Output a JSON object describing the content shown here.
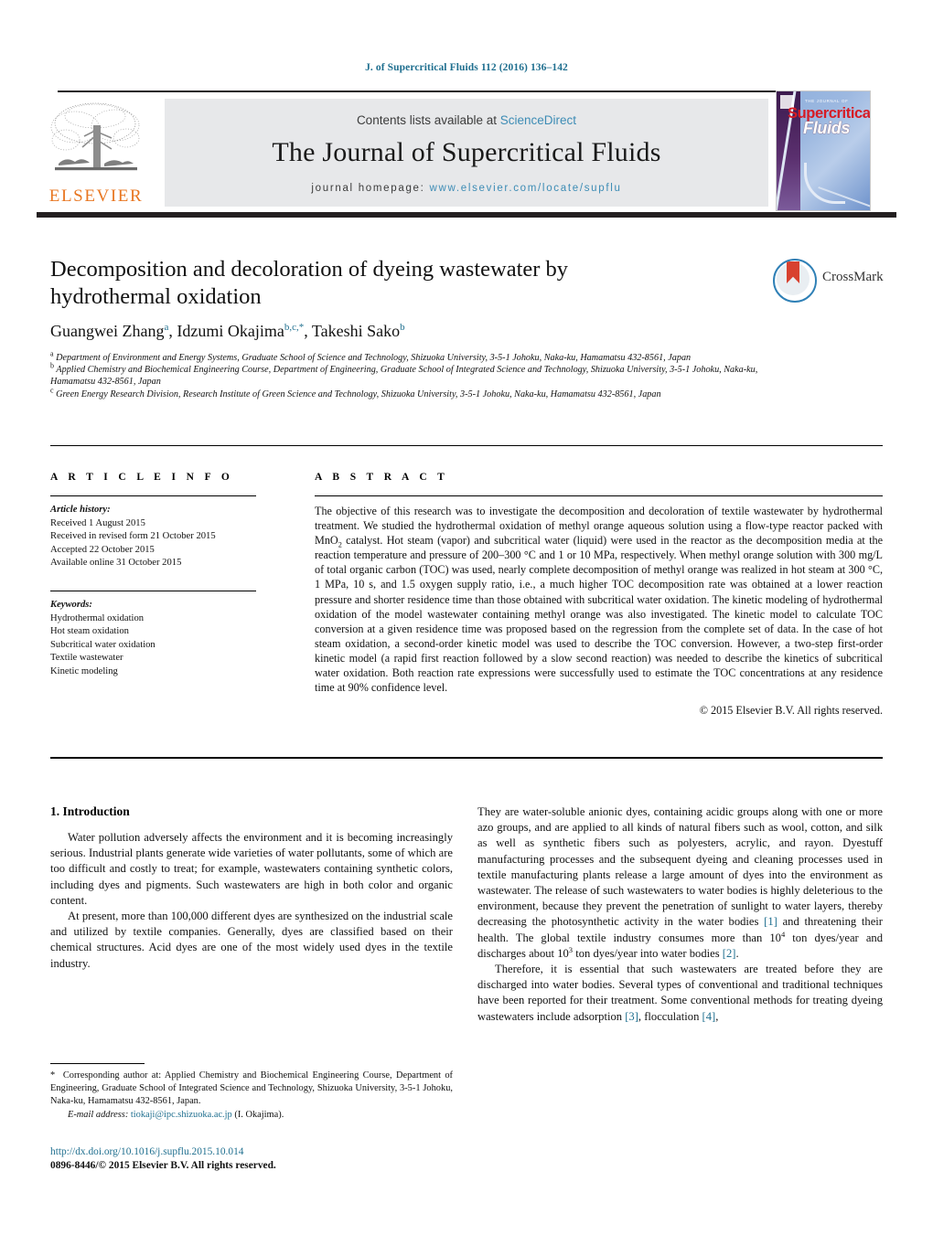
{
  "running_head": "J. of Supercritical Fluids 112 (2016) 136–142",
  "masthead": {
    "contents_prefix": "Contents lists available at ",
    "sciencedirect": "ScienceDirect",
    "journal_title": "The Journal of Supercritical Fluids",
    "homepage_label": "journal homepage:",
    "homepage_url": "www.elsevier.com/locate/supflu",
    "publisher_logo_text": "ELSEVIER",
    "cover": {
      "line1": "THE JOURNAL OF",
      "line2": "Supercritical",
      "line3": "Fluids"
    },
    "accent_gray": "#e7e8ea",
    "link_blue": "#3d8cb5",
    "elsevier_orange": "#e87722"
  },
  "crossmark": {
    "label": "CrossMark"
  },
  "article": {
    "title": "Decomposition and decoloration of dyeing wastewater by hydrothermal oxidation",
    "authors_html": "Guangwei Zhang<sup>a</sup>, Idzumi Okajima<sup>b,c,*</sup>, Takeshi Sako<sup>b</sup>",
    "affiliations": [
      "Department of Environment and Energy Systems, Graduate School of Science and Technology, Shizuoka University, 3-5-1 Johoku, Naka-ku, Hamamatsu 432-8561, Japan",
      "Applied Chemistry and Biochemical Engineering Course, Department of Engineering, Graduate School of Integrated Science and Technology, Shizuoka University, 3-5-1 Johoku, Naka-ku, Hamamatsu 432-8561, Japan",
      "Green Energy Research Division, Research Institute of Green Science and Technology, Shizuoka University, 3-5-1 Johoku, Naka-ku, Hamamatsu 432-8561, Japan"
    ],
    "affiliation_markers": [
      "a",
      "b",
      "c"
    ]
  },
  "article_info": {
    "heading": "A R T I C L E   I N F O",
    "history_label": "Article history:",
    "history": [
      "Received 1 August 2015",
      "Received in revised form 21 October 2015",
      "Accepted 22 October 2015",
      "Available online 31 October 2015"
    ],
    "keywords_label": "Keywords:",
    "keywords": [
      "Hydrothermal oxidation",
      "Hot steam oxidation",
      "Subcritical water oxidation",
      "Textile wastewater",
      "Kinetic modeling"
    ]
  },
  "abstract": {
    "heading": "A B S T R A C T",
    "body_html": "The objective of this research was to investigate the decomposition and decoloration of textile wastewater by hydrothermal treatment. We studied the hydrothermal oxidation of methyl orange aqueous solution using a flow-type reactor packed with MnO<sub>2</sub> catalyst. Hot steam (vapor) and subcritical water (liquid) were used in the reactor as the decomposition media at the reaction temperature and pressure of 200&ndash;300&nbsp;&deg;C and 1 or 10&nbsp;MPa, respectively. When methyl orange solution with 300&nbsp;mg/L of total organic carbon (TOC) was used, nearly complete decomposition of methyl orange was realized in hot steam at 300&nbsp;&deg;C, 1&nbsp;MPa, 10&nbsp;s, and 1.5 oxygen supply ratio, i.e., a much higher TOC decomposition rate was obtained at a lower reaction pressure and shorter residence time than those obtained with subcritical water oxidation. The kinetic modeling of hydrothermal oxidation of the model wastewater containing methyl orange was also investigated. The kinetic model to calculate TOC conversion at a given residence time was proposed based on the regression from the complete set of data. In the case of hot steam oxidation, a second-order kinetic model was used to describe the TOC conversion. However, a two-step first-order kinetic model (a rapid first reaction followed by a slow second reaction) was needed to describe the kinetics of subcritical water oxidation. Both reaction rate expressions were successfully used to estimate the TOC concentrations at any residence time at 90% confidence level.",
    "copyright": "© 2015 Elsevier B.V. All rights reserved."
  },
  "body": {
    "section_title": "1.  Introduction",
    "left_paragraphs": [
      "Water pollution adversely affects the environment and it is becoming increasingly serious. Industrial plants generate wide varieties of water pollutants, some of which are too difficult and costly to treat; for example, wastewaters containing synthetic colors, including dyes and pigments. Such wastewaters are high in both color and organic content.",
      "At present, more than 100,000 different dyes are synthesized on the industrial scale and utilized by textile companies. Generally, dyes are classified based on their chemical structures. Acid dyes are one of the most widely used dyes in the textile industry."
    ],
    "right_paragraph_1_html": "They are water-soluble anionic dyes, containing acidic groups along with one or more azo groups, and are applied to all kinds of natural fibers such as wool, cotton, and silk as well as synthetic fibers such as polyesters, acrylic, and rayon. Dyestuff manufacturing processes and the subsequent dyeing and cleaning processes used in textile manufacturing plants release a large amount of dyes into the environment as wastewater. The release of such wastewaters to water bodies is highly deleterious to the environment, because they prevent the penetration of sunlight to water layers, thereby decreasing the photosynthetic activity in the water bodies <span class=\"ref\">[1]</span> and threatening their health. The global textile industry consumes more than 10<sup>4</sup> ton dyes/year and discharges about 10<sup>3</sup> ton dyes/year into water bodies <span class=\"ref\">[2]</span>.",
    "right_paragraph_2_html": "Therefore, it is essential that such wastewaters are treated before they are discharged into water bodies. Several types of conventional and traditional techniques have been reported for their treatment. Some conventional methods for treating dyeing wastewaters include adsorption <span class=\"ref\">[3]</span>, flocculation <span class=\"ref\">[4]</span>,"
  },
  "footnote": {
    "corresponding_html": "<span class=\"star\">*</span>&nbsp; Corresponding author at: Applied Chemistry and Biochemical Engineering Course, Department of Engineering, Graduate School of Integrated Science and Technology, Shizuoka University, 3-5-1 Johoku, Naka-ku, Hamamatsu 432-8561, Japan.",
    "email_label": "E-mail address:",
    "email": "tiokaji@ipc.shizuoka.ac.jp",
    "email_owner": "(I. Okajima)."
  },
  "footer": {
    "doi": "http://dx.doi.org/10.1016/j.supflu.2015.10.014",
    "issn_line": "0896-8446/© 2015 Elsevier B.V. All rights reserved."
  }
}
